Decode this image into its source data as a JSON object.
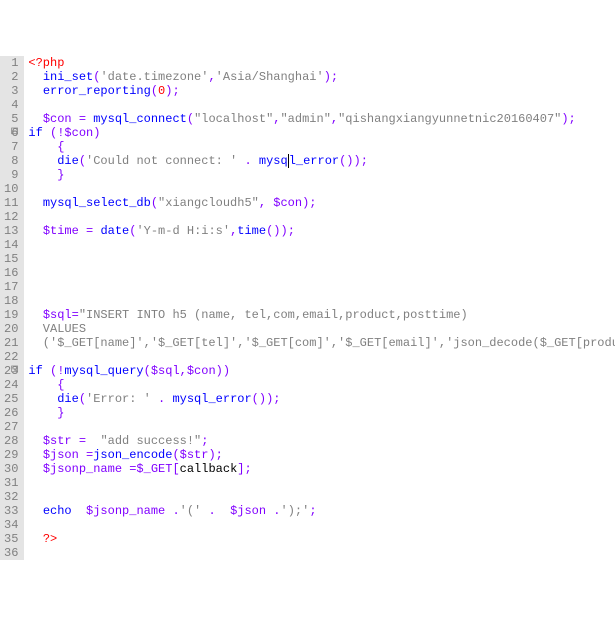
{
  "lines": [
    {
      "n": 1,
      "segs": [
        {
          "c": "k-red",
          "t": "<?php"
        }
      ]
    },
    {
      "n": 2,
      "segs": [
        {
          "c": "k-black",
          "t": "  "
        },
        {
          "c": "k-blue",
          "t": "ini_set"
        },
        {
          "c": "k-purple",
          "t": "("
        },
        {
          "c": "k-gray",
          "t": "'date.timezone'"
        },
        {
          "c": "k-purple",
          "t": ","
        },
        {
          "c": "k-gray",
          "t": "'Asia/Shanghai'"
        },
        {
          "c": "k-purple",
          "t": ");"
        }
      ]
    },
    {
      "n": 3,
      "segs": [
        {
          "c": "k-black",
          "t": "  "
        },
        {
          "c": "k-blue",
          "t": "error_reporting"
        },
        {
          "c": "k-purple",
          "t": "("
        },
        {
          "c": "k-red",
          "t": "0"
        },
        {
          "c": "k-purple",
          "t": ");"
        }
      ]
    },
    {
      "n": 4,
      "segs": []
    },
    {
      "n": 5,
      "segs": [
        {
          "c": "k-black",
          "t": "  "
        },
        {
          "c": "k-purple",
          "t": "$con"
        },
        {
          "c": "k-black",
          "t": " "
        },
        {
          "c": "k-purple",
          "t": "="
        },
        {
          "c": "k-black",
          "t": " "
        },
        {
          "c": "k-blue",
          "t": "mysql_connect"
        },
        {
          "c": "k-purple",
          "t": "("
        },
        {
          "c": "k-gray",
          "t": "\"localhost\""
        },
        {
          "c": "k-purple",
          "t": ","
        },
        {
          "c": "k-gray",
          "t": "\"admin\""
        },
        {
          "c": "k-purple",
          "t": ","
        },
        {
          "c": "k-gray",
          "t": "\"qishangxiangyunnetnic20160407\""
        },
        {
          "c": "k-purple",
          "t": ");"
        }
      ]
    },
    {
      "n": 6,
      "fold": true,
      "segs": [
        {
          "c": "k-blue",
          "t": "if"
        },
        {
          "c": "k-black",
          "t": " "
        },
        {
          "c": "k-purple",
          "t": "(!$con)"
        }
      ]
    },
    {
      "n": 7,
      "segs": [
        {
          "c": "k-black",
          "t": "    "
        },
        {
          "c": "k-purple",
          "t": "{"
        }
      ]
    },
    {
      "n": 8,
      "segs": [
        {
          "c": "k-black",
          "t": "    "
        },
        {
          "c": "k-blue",
          "t": "die"
        },
        {
          "c": "k-purple",
          "t": "("
        },
        {
          "c": "k-gray",
          "t": "'Could not connect: '"
        },
        {
          "c": "k-black",
          "t": " "
        },
        {
          "c": "k-purple",
          "t": "."
        },
        {
          "c": "k-black",
          "t": " "
        },
        {
          "c": "k-blue",
          "t": "mysq"
        },
        {
          "c": "k-blue cursor",
          "t": "l_error"
        },
        {
          "c": "k-purple",
          "t": "());"
        }
      ]
    },
    {
      "n": 9,
      "segs": [
        {
          "c": "k-black",
          "t": "    "
        },
        {
          "c": "k-purple",
          "t": "}"
        }
      ]
    },
    {
      "n": 10,
      "segs": []
    },
    {
      "n": 11,
      "segs": [
        {
          "c": "k-black",
          "t": "  "
        },
        {
          "c": "k-blue",
          "t": "mysql_select_db"
        },
        {
          "c": "k-purple",
          "t": "("
        },
        {
          "c": "k-gray",
          "t": "\"xiangcloudh5\""
        },
        {
          "c": "k-purple",
          "t": ","
        },
        {
          "c": "k-black",
          "t": " "
        },
        {
          "c": "k-purple",
          "t": "$con);"
        }
      ]
    },
    {
      "n": 12,
      "segs": []
    },
    {
      "n": 13,
      "segs": [
        {
          "c": "k-black",
          "t": "  "
        },
        {
          "c": "k-purple",
          "t": "$time"
        },
        {
          "c": "k-black",
          "t": " "
        },
        {
          "c": "k-purple",
          "t": "="
        },
        {
          "c": "k-black",
          "t": " "
        },
        {
          "c": "k-blue",
          "t": "date"
        },
        {
          "c": "k-purple",
          "t": "("
        },
        {
          "c": "k-gray",
          "t": "'Y-m-d H:i:s'"
        },
        {
          "c": "k-purple",
          "t": ","
        },
        {
          "c": "k-blue",
          "t": "time"
        },
        {
          "c": "k-purple",
          "t": "());"
        }
      ]
    },
    {
      "n": 14,
      "segs": []
    },
    {
      "n": 15,
      "segs": []
    },
    {
      "n": 16,
      "segs": []
    },
    {
      "n": 17,
      "segs": []
    },
    {
      "n": 18,
      "segs": []
    },
    {
      "n": 19,
      "segs": [
        {
          "c": "k-black",
          "t": "  "
        },
        {
          "c": "k-purple",
          "t": "$sql="
        },
        {
          "c": "k-gray",
          "t": "\"INSERT INTO h5 (name, tel,com,email,product,posttime)"
        }
      ]
    },
    {
      "n": 20,
      "segs": [
        {
          "c": "k-gray",
          "t": "  VALUES"
        }
      ]
    },
    {
      "n": 21,
      "segs": [
        {
          "c": "k-gray",
          "t": "  ('$_GET[name]','$_GET[tel]','$_GET[com]','$_GET[email]','json_decode($_GET[product])','$time')\""
        },
        {
          "c": "k-purple",
          "t": ";"
        }
      ]
    },
    {
      "n": 22,
      "segs": []
    },
    {
      "n": 23,
      "fold": true,
      "segs": [
        {
          "c": "k-blue",
          "t": "if"
        },
        {
          "c": "k-black",
          "t": " "
        },
        {
          "c": "k-purple",
          "t": "(!"
        },
        {
          "c": "k-blue",
          "t": "mysql_query"
        },
        {
          "c": "k-purple",
          "t": "($sql,$con))"
        }
      ]
    },
    {
      "n": 24,
      "segs": [
        {
          "c": "k-black",
          "t": "    "
        },
        {
          "c": "k-purple",
          "t": "{"
        }
      ]
    },
    {
      "n": 25,
      "segs": [
        {
          "c": "k-black",
          "t": "    "
        },
        {
          "c": "k-blue",
          "t": "die"
        },
        {
          "c": "k-purple",
          "t": "("
        },
        {
          "c": "k-gray",
          "t": "'Error: '"
        },
        {
          "c": "k-black",
          "t": " "
        },
        {
          "c": "k-purple",
          "t": "."
        },
        {
          "c": "k-black",
          "t": " "
        },
        {
          "c": "k-blue",
          "t": "mysql_error"
        },
        {
          "c": "k-purple",
          "t": "());"
        }
      ]
    },
    {
      "n": 26,
      "segs": [
        {
          "c": "k-black",
          "t": "    "
        },
        {
          "c": "k-purple",
          "t": "}"
        }
      ]
    },
    {
      "n": 27,
      "segs": []
    },
    {
      "n": 28,
      "segs": [
        {
          "c": "k-black",
          "t": "  "
        },
        {
          "c": "k-purple",
          "t": "$str"
        },
        {
          "c": "k-black",
          "t": " "
        },
        {
          "c": "k-purple",
          "t": "="
        },
        {
          "c": "k-black",
          "t": "  "
        },
        {
          "c": "k-gray",
          "t": "\"add success!\""
        },
        {
          "c": "k-purple",
          "t": ";"
        }
      ]
    },
    {
      "n": 29,
      "segs": [
        {
          "c": "k-black",
          "t": "  "
        },
        {
          "c": "k-purple",
          "t": "$json"
        },
        {
          "c": "k-black",
          "t": " "
        },
        {
          "c": "k-purple",
          "t": "="
        },
        {
          "c": "k-blue",
          "t": "json_encode"
        },
        {
          "c": "k-purple",
          "t": "($str);"
        }
      ]
    },
    {
      "n": 30,
      "segs": [
        {
          "c": "k-black",
          "t": "  "
        },
        {
          "c": "k-purple",
          "t": "$jsonp_name"
        },
        {
          "c": "k-black",
          "t": " "
        },
        {
          "c": "k-purple",
          "t": "=$_GET["
        },
        {
          "c": "k-black",
          "t": "callback"
        },
        {
          "c": "k-purple",
          "t": "];"
        }
      ]
    },
    {
      "n": 31,
      "segs": []
    },
    {
      "n": 32,
      "segs": []
    },
    {
      "n": 33,
      "segs": [
        {
          "c": "k-black",
          "t": "  "
        },
        {
          "c": "k-blue",
          "t": "echo"
        },
        {
          "c": "k-black",
          "t": "  "
        },
        {
          "c": "k-purple",
          "t": "$jsonp_name"
        },
        {
          "c": "k-black",
          "t": " "
        },
        {
          "c": "k-purple",
          "t": "."
        },
        {
          "c": "k-gray",
          "t": "'('"
        },
        {
          "c": "k-black",
          "t": " "
        },
        {
          "c": "k-purple",
          "t": "."
        },
        {
          "c": "k-black",
          "t": "  "
        },
        {
          "c": "k-purple",
          "t": "$json"
        },
        {
          "c": "k-black",
          "t": " "
        },
        {
          "c": "k-purple",
          "t": "."
        },
        {
          "c": "k-gray",
          "t": "');'"
        },
        {
          "c": "k-purple",
          "t": ";"
        }
      ]
    },
    {
      "n": 34,
      "segs": []
    },
    {
      "n": 35,
      "segs": [
        {
          "c": "k-black",
          "t": "  "
        },
        {
          "c": "k-red",
          "t": "?>"
        }
      ]
    },
    {
      "n": 36,
      "segs": []
    }
  ],
  "fold_glyph": "⊟"
}
